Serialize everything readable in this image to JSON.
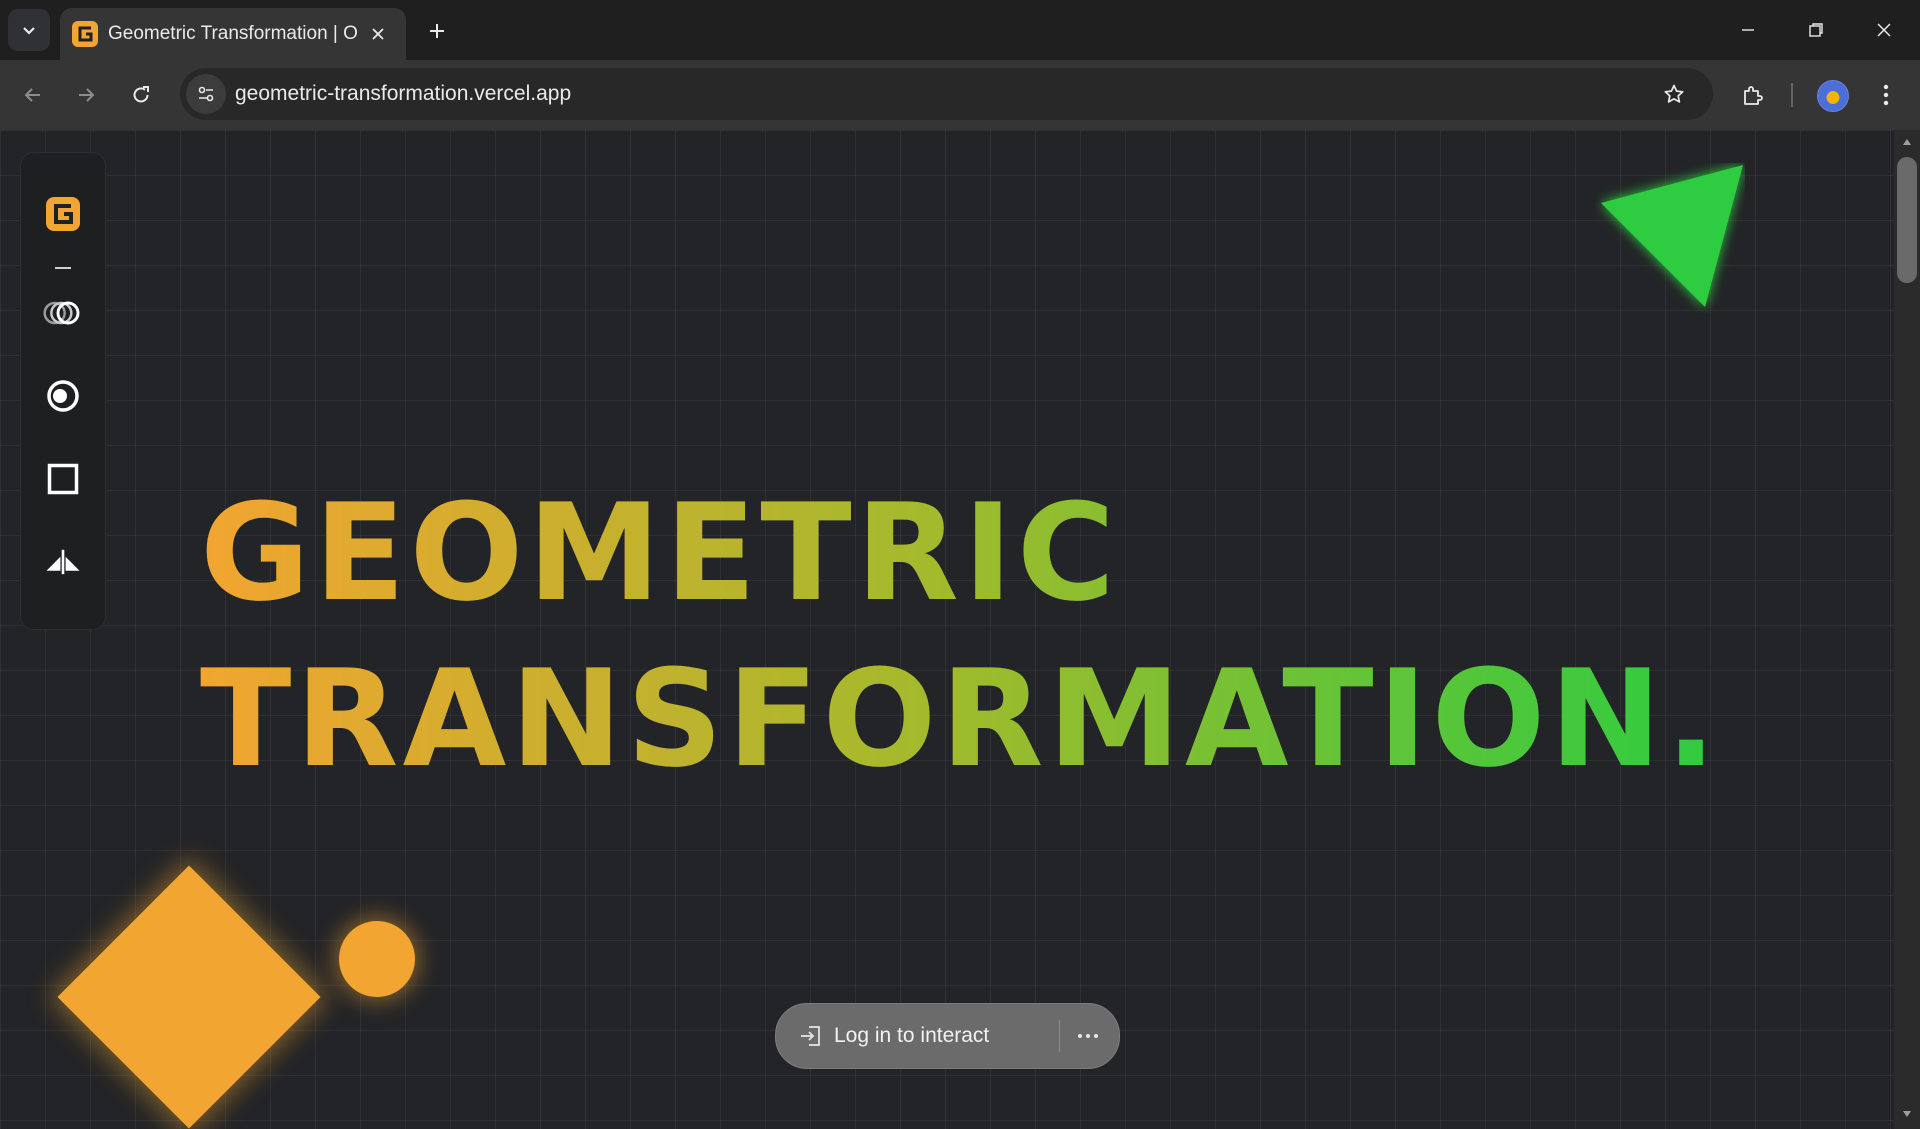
{
  "browser": {
    "tab": {
      "title": "Geometric Transformation | OS",
      "favicon": "g-logo-icon"
    },
    "address_bar": {
      "url": "geometric-transformation.vercel.app"
    }
  },
  "sidebar": {
    "items": [
      {
        "name": "logo",
        "icon": "g-logo-icon"
      },
      {
        "name": "translation",
        "icon": "overlapping-rings-icon"
      },
      {
        "name": "rotation",
        "icon": "radio-circle-icon"
      },
      {
        "name": "dilation",
        "icon": "square-outline-icon"
      },
      {
        "name": "reflection",
        "icon": "mirror-triangles-icon"
      }
    ]
  },
  "hero": {
    "line1": "GEOMETRIC",
    "line2": "TRANSFORMATION.",
    "gradient_start": "#f2a531",
    "gradient_end": "#2ecc40"
  },
  "colors": {
    "accent_orange": "#f2a531",
    "accent_green": "#2ecc40",
    "background": "#232427"
  },
  "login_bar": {
    "label": "Log in to interact",
    "icon": "login-arrow-icon",
    "more_icon": "ellipsis-icon"
  }
}
